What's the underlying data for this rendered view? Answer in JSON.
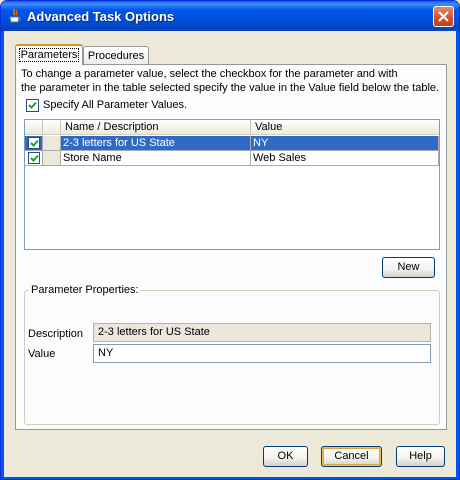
{
  "window": {
    "title": "Advanced Task Options"
  },
  "tabs": [
    {
      "label": "Parameters",
      "active": true
    },
    {
      "label": "Procedures",
      "active": false
    }
  ],
  "instructions": {
    "line1": "To change a parameter value, select the checkbox for the parameter and with",
    "line2": "the parameter in the table selected specify the value in the Value field below the table."
  },
  "specify_all": {
    "label": "Specify All Parameter Values.",
    "checked": true
  },
  "table": {
    "columns": [
      "",
      "",
      "Name / Description",
      "Value"
    ],
    "rows": [
      {
        "checked": true,
        "name": "2-3 letters for US State",
        "value": "NY",
        "selected": true
      },
      {
        "checked": true,
        "name": "Store Name",
        "value": "Web Sales",
        "selected": false
      }
    ]
  },
  "new_button": "New",
  "properties": {
    "group_label": "Parameter Properties:",
    "description_label": "Description",
    "description_value": "2-3 letters for US State",
    "value_label": "Value",
    "value_value": "NY"
  },
  "footer": {
    "ok": "OK",
    "cancel": "Cancel",
    "help": "Help"
  },
  "colors": {
    "titlebar": "#0055ea",
    "selection": "#316ac5",
    "check": "#21a121"
  }
}
